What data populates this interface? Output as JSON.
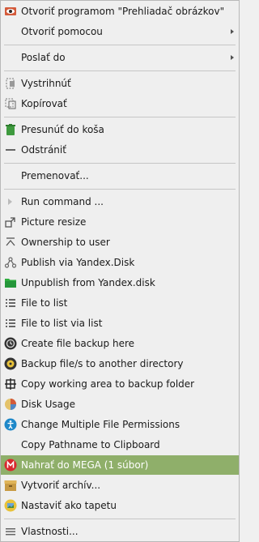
{
  "menu": {
    "items": [
      {
        "label": "Otvoriť programom \"Prehliadač obrázkov\"",
        "icon": "image-viewer-eye-icon"
      },
      {
        "label": "Otvoriť pomocou",
        "icon": "none",
        "submenu": true
      },
      {
        "label": "Poslať do",
        "icon": "none",
        "submenu": true
      },
      {
        "label": "Vystrihnúť",
        "icon": "cut-icon"
      },
      {
        "label": "Kopírovať",
        "icon": "copy-icon"
      },
      {
        "label": "Presunúť do koša",
        "icon": "trash-icon"
      },
      {
        "label": "Odstrániť",
        "icon": "delete-icon"
      },
      {
        "label": "Premenovať...",
        "icon": "none"
      },
      {
        "label": "Run command ...",
        "icon": "run-command-arrow-icon"
      },
      {
        "label": "Picture resize",
        "icon": "picture-resize-icon"
      },
      {
        "label": "Ownership to user",
        "icon": "ownership-icon"
      },
      {
        "label": "Publish via Yandex.Disk",
        "icon": "publish-share-icon"
      },
      {
        "label": "Unpublish from Yandex.disk",
        "icon": "folder-green-icon"
      },
      {
        "label": "File to list",
        "icon": "list-icon"
      },
      {
        "label": "File to list via list",
        "icon": "list-icon"
      },
      {
        "label": "Create file backup here",
        "icon": "backup-clock-icon"
      },
      {
        "label": "Backup file/s to another directory",
        "icon": "backup-disc-icon"
      },
      {
        "label": "Copy working area to backup folder",
        "icon": "working-area-icon"
      },
      {
        "label": "Disk Usage",
        "icon": "disk-usage-pie-icon"
      },
      {
        "label": "Change Multiple File Permissions",
        "icon": "accessibility-permissions-icon"
      },
      {
        "label": "Copy Pathname to Clipboard",
        "icon": "none"
      },
      {
        "label": "Nahrať do MEGA (1 súbor)",
        "icon": "mega-logo-icon",
        "selected": true
      },
      {
        "label": "Vytvoriť archív...",
        "icon": "archive-box-icon"
      },
      {
        "label": "Nastaviť ako tapetu",
        "icon": "wallpaper-icon"
      },
      {
        "label": "Vlastnosti...",
        "icon": "properties-icon"
      }
    ]
  },
  "colors": {
    "menu_bg": "#efefef",
    "selected_bg": "#8faf6a",
    "selected_text": "#ffffff",
    "separator": "#c6c6c6",
    "mega_red": "#d9272e",
    "trash_green": "#3e9a3e",
    "folder_green": "#2fae3f"
  }
}
